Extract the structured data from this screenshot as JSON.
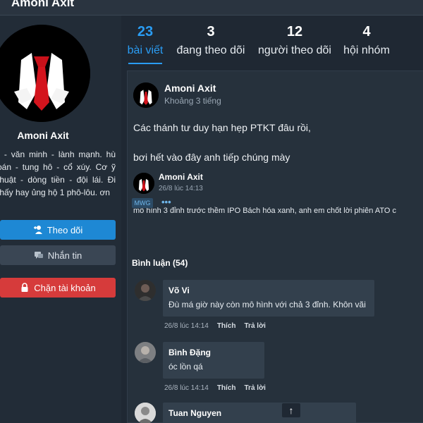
{
  "header": {
    "title": "Amoni Axit"
  },
  "profile": {
    "name": "Amoni Axit",
    "bio": "r - văn minh - lành mạnh. hù oán - tung hô - cổ xúy. Cơ ỹ thuật - dòng tiền - đội lái. Đi thấy hay ủng hộ 1 phô-lôu. ơn",
    "follow_label": "Theo dõi",
    "message_label": "Nhắn tin",
    "block_label": "Chặn tài khoản"
  },
  "stats": [
    {
      "num": "23",
      "label": "bài viết"
    },
    {
      "num": "3",
      "label": "đang theo dõi"
    },
    {
      "num": "12",
      "label": "người theo dõi"
    },
    {
      "num": "4",
      "label": "hội nhóm"
    }
  ],
  "post": {
    "author": "Amoni Axit",
    "time": "Khoảng 3 tiếng",
    "line1": "Các thánh tư duy hạn hẹp PTKT đâu rồi,",
    "line2": "bơi hết vào đây anh tiếp chúng mày",
    "shared": {
      "author": "Amoni Axit",
      "time": "26/8 lúc 14:13",
      "text": "mô hình 3 đỉnh trước thềm IPO Bách hóa xanh, anh em chốt lời phiên ATO c",
      "tag": "MWG",
      "more": "•••"
    },
    "comments_title": "Bình luận (54)",
    "comments": [
      {
        "name": "Võ Vi",
        "text": "Đù má giờ này còn mô hình với chả 3 đỉnh. Khôn vãi",
        "time": "26/8 lúc 14:14",
        "like": "Thích",
        "reply": "Trả lời"
      },
      {
        "name": "Bình Đặng",
        "text": "óc lồn qá",
        "time": "26/8 lúc 14:14",
        "like": "Thích",
        "reply": "Trả lời"
      },
      {
        "name": "Tuan Nguyen",
        "text": "",
        "time": "",
        "like": "",
        "reply": ""
      }
    ]
  },
  "scroll_top_icon": "↑",
  "colors": {
    "accent": "#2a9df4",
    "danger": "#d63b3b",
    "background": "#1f2833"
  }
}
